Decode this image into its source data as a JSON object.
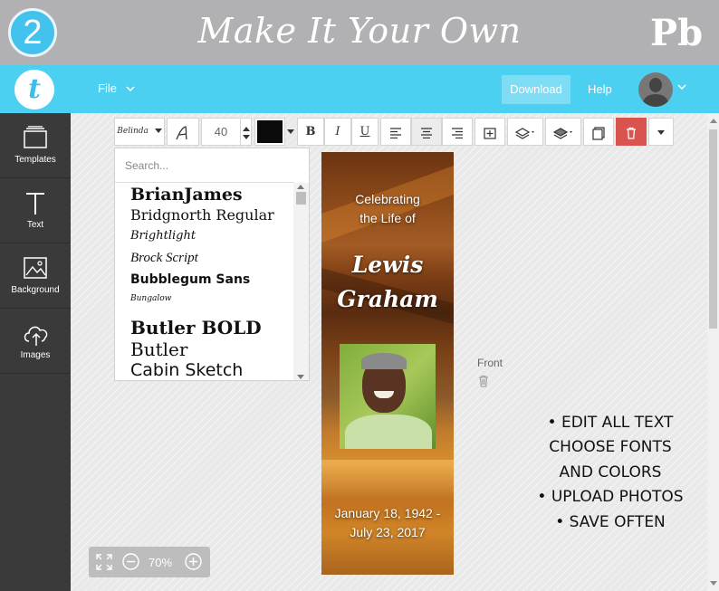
{
  "banner": {
    "step_number": "2",
    "title": "Make It Your Own",
    "brand_logo_text": "Pb"
  },
  "appbar": {
    "logo_text": "t",
    "file_menu": "File",
    "download_label": "Download",
    "help_label": "Help"
  },
  "sidebar": {
    "items": [
      {
        "label": "Templates",
        "icon": "templates-icon"
      },
      {
        "label": "Text",
        "icon": "text-icon"
      },
      {
        "label": "Background",
        "icon": "background-icon"
      },
      {
        "label": "Images",
        "icon": "cloud-upload-icon"
      }
    ]
  },
  "format_toolbar": {
    "font_family": "Belinda",
    "font_size": "40",
    "text_color": "#0a0a0a",
    "bold": "B",
    "italic": "I",
    "underline": "U",
    "delete_color": "#d9534f"
  },
  "font_panel": {
    "search_placeholder": "Search...",
    "fonts": [
      "BrianJames",
      "Bridgnorth Regular",
      "Brightlight",
      "Brock Script",
      "Bubblegum Sans",
      "Bungalow",
      "Butler BOLD",
      "Butler",
      "Cabin Sketch"
    ]
  },
  "bookmark": {
    "celebrating_line1": "Celebrating",
    "celebrating_line2": "the Life of",
    "first_name": "Lewis",
    "last_name": "Graham",
    "date_line1": "January 18, 1942 -",
    "date_line2": "July 23, 2017"
  },
  "canvas": {
    "side_label": "Front"
  },
  "promo": {
    "lines": [
      "• EDIT ALL TEXT",
      "CHOOSE FONTS",
      "AND COLORS",
      "• UPLOAD PHOTOS",
      "• SAVE  OFTEN"
    ]
  },
  "zoom": {
    "level": "70%"
  },
  "colors": {
    "banner_gray": "#b1b1b3",
    "appbar_blue": "#4bd0f2",
    "sidebar_dark": "#3a3a3a"
  }
}
